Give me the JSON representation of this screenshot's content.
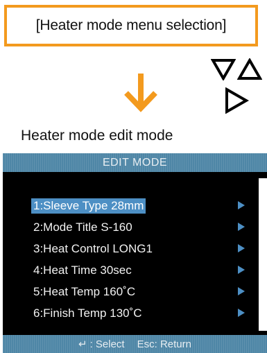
{
  "menu_selection_label": "[Heater mode menu selection]",
  "caption": "Heater mode edit mode",
  "screen": {
    "header_title": "EDIT MODE",
    "items": [
      {
        "label": "1:Sleeve Type 28mm",
        "selected": true
      },
      {
        "label": "2:Mode Title S-160",
        "selected": false
      },
      {
        "label": "3:Heat Control LONG1",
        "selected": false
      },
      {
        "label": "4:Heat Time 30sec",
        "selected": false
      },
      {
        "label": "5:Heat Temp 160˚C",
        "selected": false
      },
      {
        "label": "6:Finish Temp 130˚C",
        "selected": false
      }
    ],
    "footer": {
      "enter_symbol": "↵",
      "select_label": ": Select",
      "return_label": "Esc: Return"
    }
  },
  "colors": {
    "accent_orange": "#f39a1e",
    "bar_blue": "#4e86a6",
    "highlight_blue": "#4d8fc4",
    "screen_bg": "#000000"
  },
  "icons": {
    "flow_arrow": "arrow-down-icon",
    "keys": [
      "triangle-down-icon",
      "triangle-up-icon",
      "triangle-right-icon"
    ],
    "row_indicator": "triangle-right-icon"
  }
}
